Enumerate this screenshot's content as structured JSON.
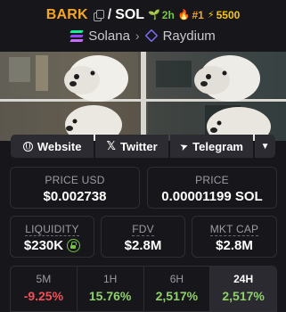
{
  "header": {
    "base_symbol": "BARK",
    "separator": "/",
    "quote_symbol": "SOL",
    "badges": {
      "age": "2h",
      "rank": "#1",
      "boosts": "5500"
    },
    "chain": "Solana",
    "dex": "Raydium"
  },
  "links": {
    "website": "Website",
    "twitter": "Twitter",
    "telegram": "Telegram"
  },
  "stats": {
    "price_usd_label": "PRICE USD",
    "price_usd": "$0.002738",
    "price_native_label": "PRICE",
    "price_native": "0.00001199 SOL",
    "liquidity_label": "LIQUIDITY",
    "liquidity": "$230K",
    "fdv_label": "FDV",
    "fdv": "$2.8M",
    "mcap_label": "MKT CAP",
    "mcap": "$2.8M"
  },
  "changes": [
    {
      "period": "5M",
      "value": "-9.25%"
    },
    {
      "period": "1H",
      "value": "15.76%"
    },
    {
      "period": "6H",
      "value": "2,517%"
    },
    {
      "period": "24H",
      "value": "2,517%"
    }
  ],
  "colors": {
    "accent_orange": "#f5a524",
    "positive": "#8fd16a",
    "negative": "#f04f58",
    "background": "#17171b"
  }
}
